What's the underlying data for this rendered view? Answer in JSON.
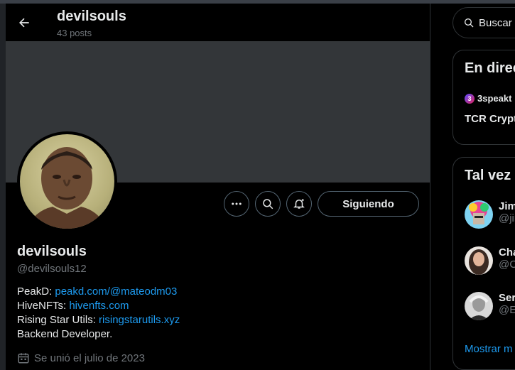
{
  "header": {
    "name": "devilsouls",
    "posts": "43 posts"
  },
  "profile": {
    "name": "devilsouls",
    "handle": "@devilsouls12",
    "follow_label": "Siguiendo",
    "joined": "Se unió el julio de 2023",
    "bio": [
      {
        "label": "PeakD: ",
        "link": "peakd.com/@mateodm03"
      },
      {
        "label": "HiveNFTs: ",
        "link": "hivenfts.com"
      },
      {
        "label": "Rising Star Utils: ",
        "link": "risingstarutils.xyz"
      },
      {
        "label": "Backend Developer.",
        "link": ""
      }
    ]
  },
  "sidebar": {
    "search_placeholder": "Buscar",
    "live_title": "En direc",
    "live_host": "3speakt",
    "live_topic": "TCR Crypt",
    "suggest_title": "Tal vez",
    "suggestions": [
      {
        "name": "Jim",
        "handle": "@jir"
      },
      {
        "name": "Cha",
        "handle": "@C"
      },
      {
        "name": "Ser",
        "handle": "@E"
      }
    ],
    "show_more": "Mostrar m"
  },
  "colors": {
    "accent": "#1d9bf0",
    "muted": "#71767b",
    "border": "#2f3336",
    "banner": "#333639"
  },
  "icons": [
    "back-arrow-icon",
    "more-icon",
    "search-icon",
    "notification-bell-icon",
    "calendar-icon"
  ]
}
